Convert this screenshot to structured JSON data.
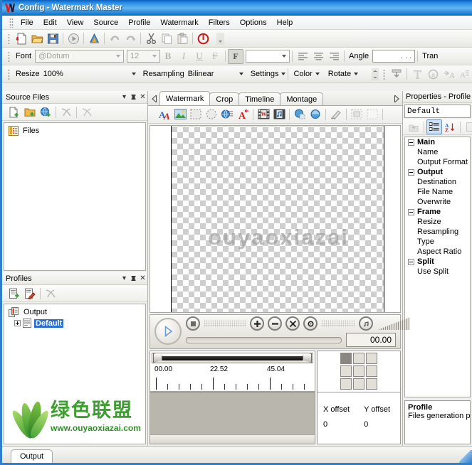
{
  "window": {
    "title": "Config - Watermark Master",
    "icon": "app-logo-icon"
  },
  "menu": {
    "items": [
      {
        "label": "File"
      },
      {
        "label": "Edit"
      },
      {
        "label": "View"
      },
      {
        "label": "Source"
      },
      {
        "label": "Profile"
      },
      {
        "label": "Watermark"
      },
      {
        "label": "Filters"
      },
      {
        "label": "Options"
      },
      {
        "label": "Help"
      }
    ]
  },
  "main_toolbar": {
    "buttons": [
      {
        "name": "new-icon"
      },
      {
        "name": "open-folder-icon"
      },
      {
        "name": "save-icon"
      },
      {
        "name": "run-icon"
      },
      {
        "name": "convert-icon"
      },
      {
        "name": "undo-icon"
      },
      {
        "name": "redo-icon"
      },
      {
        "name": "cut-icon"
      },
      {
        "name": "copy-icon"
      },
      {
        "name": "paste-icon"
      },
      {
        "name": "stop-icon"
      }
    ]
  },
  "font_toolbar": {
    "font_label": "Font",
    "font_value": "@Dotum",
    "font_size": "12",
    "bold": "B",
    "italic": "I",
    "underline": "U",
    "strike": "F",
    "effect": "F",
    "color_value": "",
    "align_left": "align-left-icon",
    "align_center": "align-center-icon",
    "align_right": "align-right-icon",
    "angle_label": "Angle",
    "angle_value": ". . .",
    "transparency_label": "Tran"
  },
  "resize_toolbar": {
    "resize_label": "Resize",
    "resize_value": "100%",
    "resampling_label": "Resampling",
    "resampling_value": "Bilinear",
    "settings_label": "Settings",
    "color_label": "Color",
    "rotate_label": "Rotate"
  },
  "source_panel": {
    "title": "Source Files",
    "toolbar": [
      {
        "name": "add-file-icon"
      },
      {
        "name": "add-folder-icon"
      },
      {
        "name": "add-url-icon"
      },
      {
        "name": "remove-icon"
      },
      {
        "name": "remove-all-icon"
      }
    ],
    "root_label": "Files"
  },
  "profiles_panel": {
    "title": "Profiles",
    "toolbar": [
      {
        "name": "new-profile-icon"
      },
      {
        "name": "edit-profile-icon"
      },
      {
        "name": "delete-profile-icon"
      }
    ],
    "root_label": "Output",
    "selected_label": "Default"
  },
  "center": {
    "tabs": [
      {
        "label": "Watermark",
        "active": true
      },
      {
        "label": "Crop",
        "active": false
      },
      {
        "label": "Timeline",
        "active": false
      },
      {
        "label": "Montage",
        "active": false
      }
    ],
    "toolbar": [
      {
        "name": "text-watermark-icon"
      },
      {
        "name": "image-watermark-icon"
      },
      {
        "name": "rectangle-icon"
      },
      {
        "name": "ellipse-icon"
      },
      {
        "name": "html-watermark-icon"
      },
      {
        "name": "marquee-text-icon"
      },
      {
        "name": "video-watermark-icon"
      },
      {
        "name": "audio-watermark-icon"
      },
      {
        "name": "shape-icon"
      },
      {
        "name": "mask-icon"
      },
      {
        "name": "eraser-icon"
      },
      {
        "name": "select-region-icon"
      },
      {
        "name": "deselect-icon"
      }
    ],
    "watermark_preview_text": "ouyaoxiazai"
  },
  "playback": {
    "play": "play-icon",
    "stop": "stop-icon",
    "zoom_in": "zoom-in-icon",
    "zoom_out": "zoom-out-icon",
    "fit": "fit-icon",
    "actual_size": "actual-size-icon",
    "audio": "audio-icon",
    "volume": "volume-slider",
    "time_value": "00.00"
  },
  "timeline": {
    "ruler_labels": [
      "00.00",
      "22.52",
      "45.04"
    ]
  },
  "anchor": {
    "cells": [
      {
        "selected": true
      },
      {
        "selected": false
      },
      {
        "selected": false
      },
      {
        "selected": false
      },
      {
        "selected": false
      },
      {
        "selected": false
      },
      {
        "selected": false
      },
      {
        "selected": false
      },
      {
        "selected": false
      }
    ],
    "x_offset_label": "X offset",
    "x_offset_value": "0",
    "y_offset_label": "Y offset",
    "y_offset_value": "0"
  },
  "properties": {
    "title": "Properties - Profile",
    "value": "Default",
    "toolbar": [
      {
        "name": "parent-icon"
      },
      {
        "name": "categorized-icon"
      },
      {
        "name": "sort-alpha-icon"
      },
      {
        "name": "property-pages-icon"
      }
    ],
    "groups": [
      {
        "name": "Main",
        "items": [
          "Name",
          "Output Format"
        ]
      },
      {
        "name": "Output",
        "items": [
          "Destination",
          "File Name",
          "Overwrite"
        ]
      },
      {
        "name": "Frame",
        "items": [
          "Resize",
          "Resampling",
          "Type",
          "Aspect Ratio"
        ]
      },
      {
        "name": "Split",
        "items": [
          "Use Split"
        ]
      }
    ],
    "description_title": "Profile",
    "description_text": "Files generation par"
  },
  "overlay_logo": {
    "cn_text": "绿色联盟",
    "url_text": "www.ouyaoxiazai.com"
  },
  "bottom": {
    "tab_label": "Output"
  },
  "colors": {
    "titlebar_blue": "#2a8de4",
    "selection_blue": "#2a6fd0",
    "logo_green": "#3f9e32",
    "accent_red": "#cc2222"
  }
}
